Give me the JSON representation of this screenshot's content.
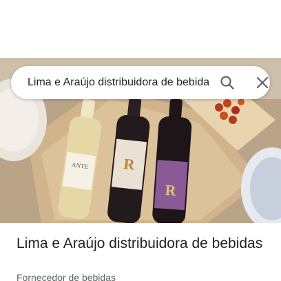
{
  "search": {
    "query": "Lima e Araújo distribuidora de bebidas",
    "search_icon": "search-icon",
    "close_icon": "close-icon"
  },
  "hero": {
    "bottle_left_label": "ANTE",
    "bottle_middle_label": "R",
    "bottle_right_label": "R"
  },
  "place": {
    "name": "Lima e Araújo distribuidora de bebidas",
    "category": "Fornecedor de bebidas"
  },
  "colors": {
    "text_primary": "#202124",
    "text_secondary": "#5f6368",
    "icon": "#5f6368"
  }
}
